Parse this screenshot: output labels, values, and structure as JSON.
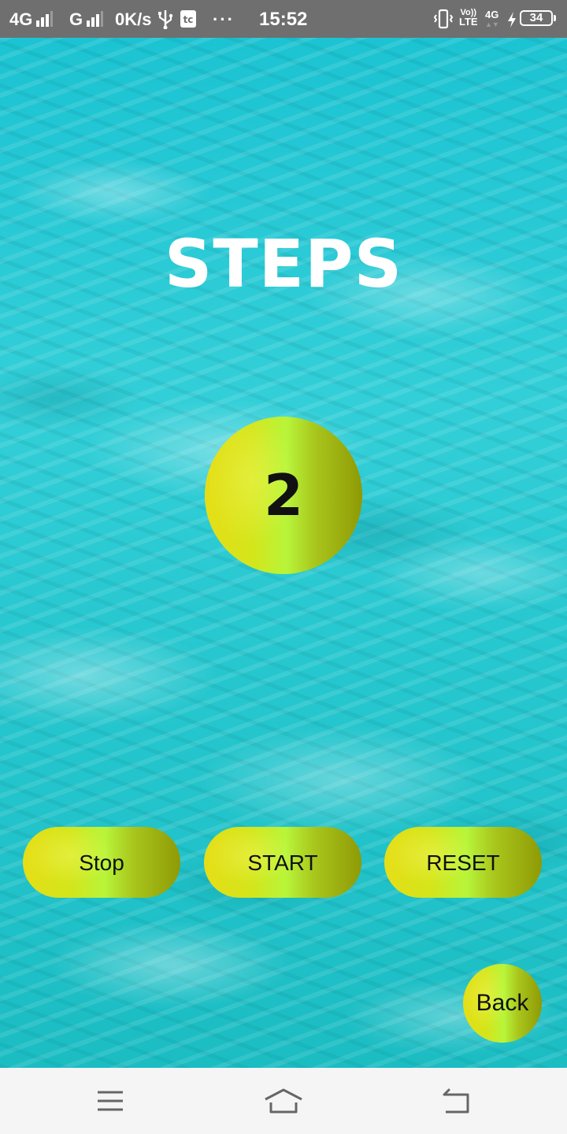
{
  "status_bar": {
    "network1": "4G",
    "network2": "G",
    "speed": "0K/s",
    "dots": "···",
    "time": "15:52",
    "volte_top": "Vo))",
    "volte_bottom": "LTE",
    "network3": "4G",
    "battery": "34",
    "icons": [
      "signal-icon",
      "usb-icon",
      "notification-icon",
      "vibrate-icon",
      "charging-icon",
      "battery-icon"
    ]
  },
  "app": {
    "title": "STEPS",
    "step_count": "2",
    "buttons": {
      "stop": "Stop",
      "start": "START",
      "reset": "RESET",
      "back": "Back"
    }
  },
  "nav_bar": {
    "icons": [
      "menu-icon",
      "home-icon",
      "back-arrow-icon"
    ]
  },
  "colors": {
    "water": "#27c7cf",
    "button_gradient_start": "#e6de17",
    "button_gradient_mid": "#b8f53a",
    "button_gradient_end": "#8f9a05",
    "status_bar": "#6f6f6f",
    "nav_bar": "#f5f5f5"
  }
}
